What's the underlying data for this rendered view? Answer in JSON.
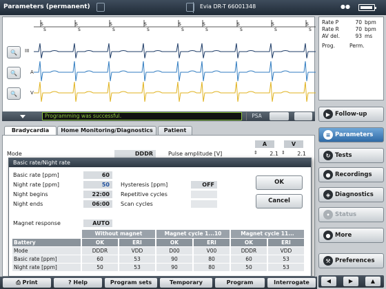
{
  "title_bar": {
    "title": "Parameters (permanent)",
    "device": "Evia DR-T 66001348"
  },
  "ecg": {
    "channels": [
      "III",
      "A",
      "V"
    ],
    "status": "Programming was successful.",
    "psa": "PSA"
  },
  "info": {
    "rows": [
      {
        "label": "Rate P",
        "value": "70",
        "unit": "bpm"
      },
      {
        "label": "Rate R",
        "value": "70",
        "unit": "bpm"
      },
      {
        "label": "AV del.",
        "value": "93",
        "unit": "ms"
      }
    ],
    "prog_label": "Prog.",
    "prog_value": "Perm."
  },
  "nav": {
    "followup": "Follow-up",
    "parameters": "Parameters",
    "tests": "Tests",
    "recordings": "Recordings",
    "diagnostics": "Diagnostics",
    "status": "Status",
    "more": "More",
    "preferences": "Preferences"
  },
  "tabs": [
    "Bradycardia",
    "Home Monitoring/Diagnostics",
    "Patient"
  ],
  "main": {
    "mode_label": "Mode",
    "mode_value": "DDDR",
    "pulse_amp_label": "Pulse amplitude  [V]",
    "col_a": "A",
    "col_v": "V",
    "pa_a": "2.1",
    "pa_v": "2.1"
  },
  "dialog": {
    "title": "Basic rate/Night rate",
    "basic_rate_label": "Basic rate [ppm]",
    "basic_rate": "60",
    "night_rate_label": "Night rate [ppm]",
    "night_rate": "50",
    "night_begins_label": "Night begins",
    "night_begins": "22:00",
    "night_ends_label": "Night ends",
    "night_ends": "06:00",
    "hysteresis_label": "Hysteresis [ppm]",
    "hysteresis": "OFF",
    "repetitive_label": "Repetitive cycles",
    "scan_label": "Scan cycles",
    "ok": "OK",
    "cancel": "Cancel",
    "magnet_label": "Magnet response",
    "magnet_value": "AUTO",
    "table": {
      "groups": [
        "Without magnet",
        "Magnet cycle 1...10",
        "Magnet cycle 11..."
      ],
      "battery_label": "Battery",
      "subheads": [
        "OK",
        "ERI",
        "OK",
        "ERI",
        "OK",
        "ERI"
      ],
      "rows": [
        {
          "label": "Mode",
          "cells": [
            "DDDR",
            "VDD",
            "D00",
            "V00",
            "DDDR",
            "VDD"
          ]
        },
        {
          "label": "Basic rate [ppm]",
          "cells": [
            "60",
            "53",
            "90",
            "80",
            "60",
            "53"
          ]
        },
        {
          "label": "Night rate [ppm]",
          "cells": [
            "50",
            "53",
            "90",
            "80",
            "50",
            "53"
          ]
        }
      ]
    }
  },
  "toolbar": {
    "print": "Print",
    "help": "Help",
    "program_sets": "Program sets",
    "temporary": "Temporary",
    "program": "Program",
    "interrogate": "Interrogate"
  }
}
